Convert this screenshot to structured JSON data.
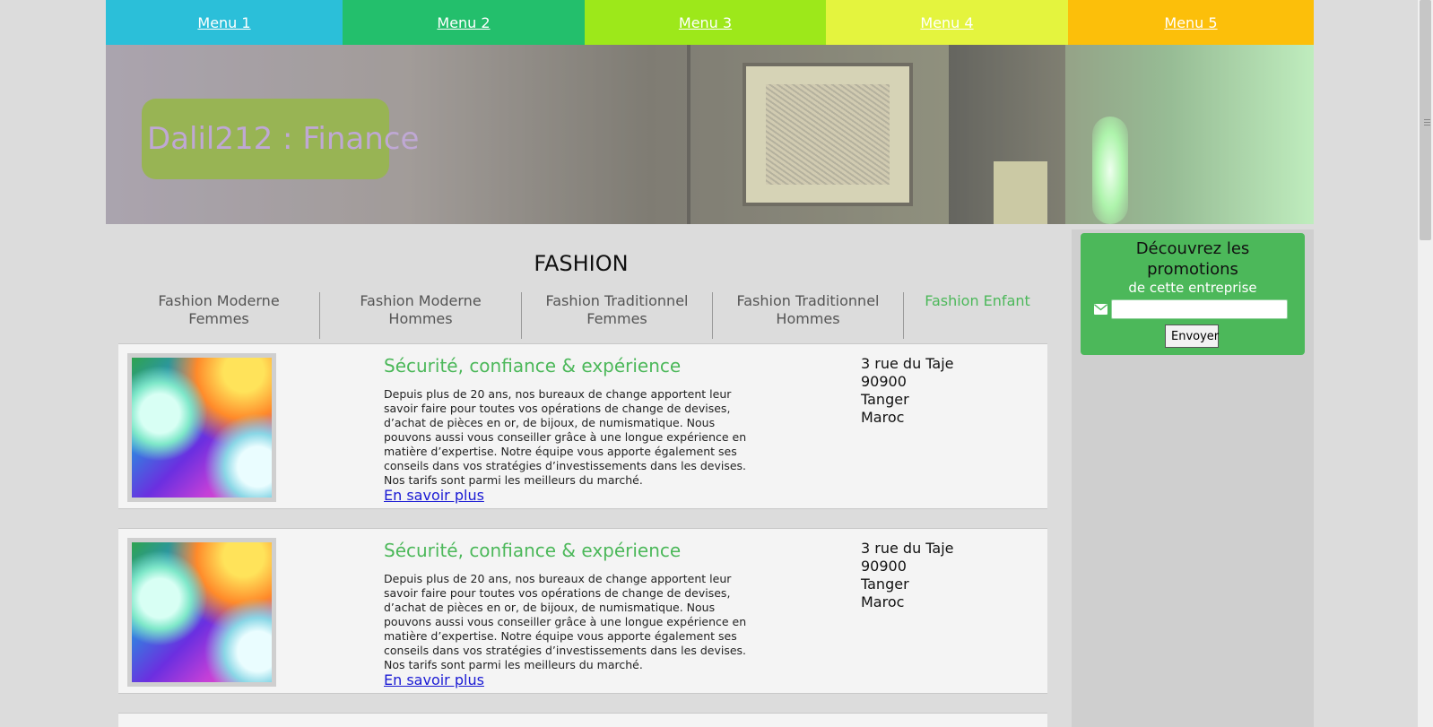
{
  "menu": {
    "items": [
      {
        "label": "Menu 1",
        "color": "#2bbfd9"
      },
      {
        "label": "Menu 2",
        "color": "#23bf6c"
      },
      {
        "label": "Menu 3",
        "color": "#9de81a"
      },
      {
        "label": "Menu 4",
        "color": "#e4f43e"
      },
      {
        "label": "Menu 5",
        "color": "#fcbf0a"
      }
    ]
  },
  "banner": {
    "logo_text": "Dalil212 : Finance",
    "logo_bg": "#98b454"
  },
  "main": {
    "section_title": "FASHION",
    "tabs": [
      {
        "label": "Fashion Moderne Femmes",
        "active": false
      },
      {
        "label": "Fashion Moderne Hommes",
        "active": false
      },
      {
        "label": "Fashion Traditionnel Femmes",
        "active": false
      },
      {
        "label": "Fashion Traditionnel Hommes",
        "active": false
      },
      {
        "label": "Fashion Enfant",
        "active": true
      }
    ],
    "cards": [
      {
        "title": "Sécurité, confiance & expérience",
        "description": "Depuis plus de 20 ans, nos bureaux de change apportent leur savoir faire pour toutes vos opérations de change de devises, d’achat de pièces en or, de bijoux, de numismatique. Nous pouvons aussi vous conseiller grâce à une longue expérience en matière d’expertise. Notre équipe vous apporte également ses conseils dans vos stratégies d’investissements dans les devises. Nos tarifs sont parmi les meilleurs du marché.",
        "link": "En savoir plus",
        "address": [
          "3 rue du Taje",
          "90900",
          "Tanger",
          "Maroc"
        ]
      },
      {
        "title": "Sécurité, confiance & expérience",
        "description": "Depuis plus de 20 ans, nos bureaux de change apportent leur savoir faire pour toutes vos opérations de change de devises, d’achat de pièces en or, de bijoux, de numismatique. Nous pouvons aussi vous conseiller grâce à une longue expérience en matière d’expertise. Notre équipe vous apporte également ses conseils dans vos stratégies d’investissements dans les devises. Nos tarifs sont parmi les meilleurs du marché.",
        "link": "En savoir plus",
        "address": [
          "3 rue du Taje",
          "90900",
          "Tanger",
          "Maroc"
        ]
      }
    ]
  },
  "sidebar": {
    "promo_title_line1": "Découvrez les",
    "promo_title_line2": "promotions",
    "promo_subtitle": "de cette entreprise",
    "email_icon": "envelope-icon",
    "email_value": "",
    "submit_label": "Envoyer",
    "accent": "#4cb85a"
  },
  "colors": {
    "page_bg": "#dcdcdc",
    "accent_green": "#4cb85a",
    "link_blue": "#1a1ad4"
  }
}
